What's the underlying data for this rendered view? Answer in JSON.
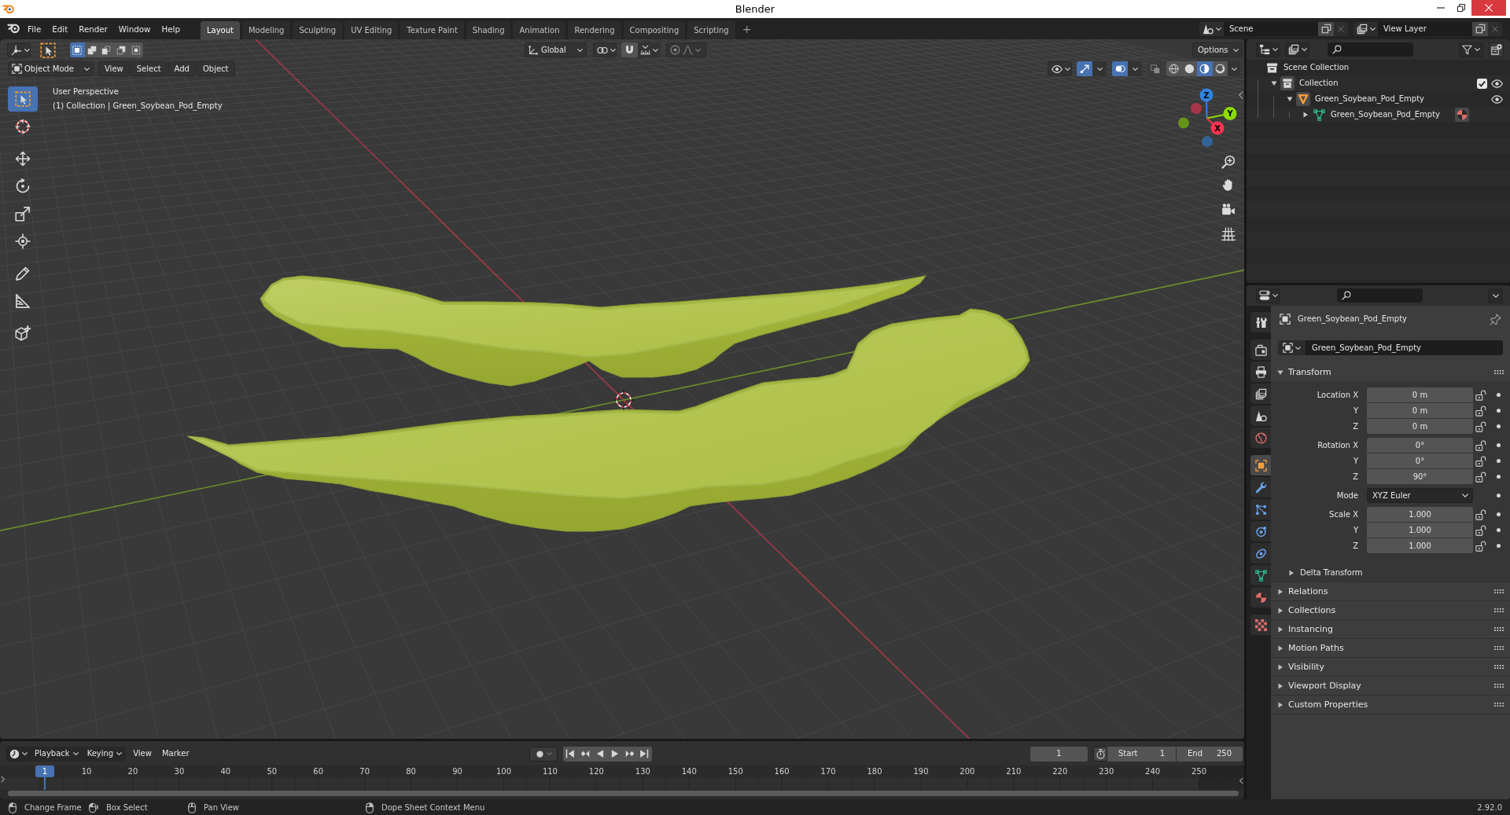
{
  "window": {
    "title": "Blender"
  },
  "menu": [
    "File",
    "Edit",
    "Render",
    "Window",
    "Help"
  ],
  "workspaces": [
    {
      "label": "Layout",
      "selected": true
    },
    {
      "label": "Modeling",
      "selected": false
    },
    {
      "label": "Sculpting",
      "selected": false
    },
    {
      "label": "UV Editing",
      "selected": false
    },
    {
      "label": "Texture Paint",
      "selected": false
    },
    {
      "label": "Shading",
      "selected": false
    },
    {
      "label": "Animation",
      "selected": false
    },
    {
      "label": "Rendering",
      "selected": false
    },
    {
      "label": "Compositing",
      "selected": false
    },
    {
      "label": "Scripting",
      "selected": false
    }
  ],
  "add_workspace": "+",
  "scene": "Scene",
  "view_layer": "View Layer",
  "tool_settings": {
    "select_modes": [
      {
        "kind": "set",
        "selected": true
      },
      {
        "kind": "extend",
        "selected": false
      },
      {
        "kind": "subtract",
        "selected": false
      },
      {
        "kind": "invert",
        "selected": false
      },
      {
        "kind": "intersect",
        "selected": false
      }
    ],
    "orientation": "Global",
    "options": "Options"
  },
  "viewport": {
    "mode": "Object Mode",
    "menus": [
      "View",
      "Select",
      "Add",
      "Object"
    ],
    "gizmos": true,
    "overlays": true,
    "xray": false,
    "shading": [
      {
        "kind": "wireframe",
        "selected": false
      },
      {
        "kind": "solid",
        "selected": false
      },
      {
        "kind": "material",
        "selected": true
      },
      {
        "kind": "rendered",
        "selected": false
      }
    ],
    "view_name": "User Perspective",
    "context": "(1) Collection | Green_Soybean_Pod_Empty",
    "tools": [
      [
        {
          "kind": "select_box",
          "selected": true
        },
        {
          "kind": "cursor",
          "selected": false
        }
      ],
      [
        {
          "kind": "move",
          "selected": false
        },
        {
          "kind": "rotate",
          "selected": false
        },
        {
          "kind": "scale",
          "selected": false
        },
        {
          "kind": "transform",
          "selected": false
        }
      ],
      [
        {
          "kind": "annotate",
          "selected": false
        },
        {
          "kind": "measure",
          "selected": false
        }
      ],
      [
        {
          "kind": "add_cube",
          "selected": false
        }
      ]
    ],
    "axes": [
      {
        "label": "Z",
        "color": "#2f83e3"
      },
      {
        "label": "Y",
        "color": "#8bdc00"
      },
      {
        "label": "X",
        "color": "#ff3352"
      }
    ]
  },
  "outliner": {
    "tree": [
      {
        "label": "Scene Collection",
        "kind": "scene_collection",
        "children": [
          {
            "label": "Collection",
            "kind": "collection",
            "expanded": true,
            "checked": true,
            "visible": true,
            "children": [
              {
                "label": "Green_Soybean_Pod_Empty",
                "kind": "object",
                "expanded": true,
                "visible": true,
                "children": [
                  {
                    "label": "Green_Soybean_Pod_Empty",
                    "kind": "mesh",
                    "expanded": false,
                    "has_material": true
                  }
                ]
              }
            ]
          }
        ]
      }
    ]
  },
  "properties": {
    "tabs": [
      [
        {
          "kind": "tool",
          "selected": false
        }
      ],
      [
        {
          "kind": "render",
          "selected": false
        },
        {
          "kind": "output",
          "selected": false
        },
        {
          "kind": "view_layer",
          "selected": false
        },
        {
          "kind": "scene",
          "selected": false
        },
        {
          "kind": "world",
          "selected": false
        }
      ],
      [
        {
          "kind": "object",
          "selected": true
        },
        {
          "kind": "modifiers",
          "selected": false
        },
        {
          "kind": "particles",
          "selected": false
        },
        {
          "kind": "physics",
          "selected": false
        },
        {
          "kind": "constraints",
          "selected": false
        },
        {
          "kind": "data",
          "selected": false
        },
        {
          "kind": "material",
          "selected": false
        }
      ],
      [
        {
          "kind": "texture",
          "selected": false
        }
      ]
    ],
    "object_name": "Green_Soybean_Pod_Empty",
    "datablock": "Green_Soybean_Pod_Empty",
    "panels": [
      {
        "title": "Transform",
        "expanded": true,
        "groups": [
          [
            {
              "label": "Location X",
              "value": "0 m",
              "kind": "number",
              "locked": false
            },
            {
              "label": "Y",
              "value": "0 m",
              "kind": "number",
              "locked": false
            },
            {
              "label": "Z",
              "value": "0 m",
              "kind": "number",
              "locked": false
            }
          ],
          [
            {
              "label": "Rotation X",
              "value": "0°",
              "kind": "number",
              "locked": false
            },
            {
              "label": "Y",
              "value": "0°",
              "kind": "number",
              "locked": false
            },
            {
              "label": "Z",
              "value": "90°",
              "kind": "number",
              "locked": false
            }
          ],
          [
            {
              "label": "Mode",
              "value": "XYZ Euler",
              "kind": "dropdown"
            }
          ],
          [
            {
              "label": "Scale X",
              "value": "1.000",
              "kind": "number",
              "locked": false
            },
            {
              "label": "Y",
              "value": "1.000",
              "kind": "number",
              "locked": false
            },
            {
              "label": "Z",
              "value": "1.000",
              "kind": "number",
              "locked": false
            }
          ]
        ],
        "subpanels": [
          {
            "title": "Delta Transform",
            "expanded": false
          }
        ]
      },
      {
        "title": "Relations",
        "expanded": false
      },
      {
        "title": "Collections",
        "expanded": false
      },
      {
        "title": "Instancing",
        "expanded": false
      },
      {
        "title": "Motion Paths",
        "expanded": false
      },
      {
        "title": "Visibility",
        "expanded": false
      },
      {
        "title": "Viewport Display",
        "expanded": false
      },
      {
        "title": "Custom Properties",
        "expanded": false
      }
    ]
  },
  "timeline": {
    "menus": [
      {
        "label": "Playback",
        "kind": "dropdown"
      },
      {
        "label": "Keying",
        "kind": "dropdown"
      },
      {
        "label": "View",
        "kind": "menu"
      },
      {
        "label": "Marker",
        "kind": "menu"
      }
    ],
    "current_frame": "1",
    "start": {
      "label": "Start",
      "value": "1"
    },
    "end": {
      "label": "End",
      "value": "250"
    },
    "playhead": "1",
    "ruler": [
      "10",
      "20",
      "30",
      "40",
      "50",
      "60",
      "70",
      "80",
      "90",
      "100",
      "110",
      "120",
      "130",
      "140",
      "150",
      "160",
      "170",
      "180",
      "190",
      "200",
      "210",
      "220",
      "230",
      "240",
      "250"
    ]
  },
  "status_bar": {
    "hints": [
      {
        "kind": "left_click",
        "label": "Change Frame"
      },
      {
        "kind": "drag",
        "label": "Box Select"
      },
      {
        "kind": "middle_click",
        "label": "Pan View"
      },
      {
        "kind": "right_click",
        "label": "Dope Sheet Context Menu"
      }
    ],
    "version": "2.92.0"
  }
}
